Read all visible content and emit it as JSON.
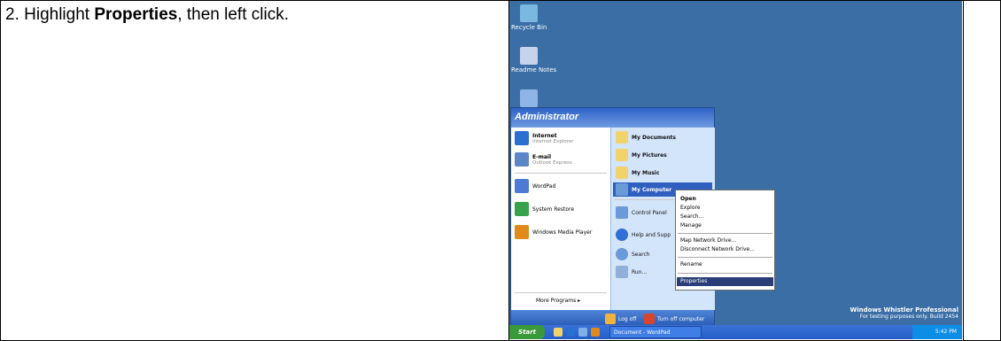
{
  "instruction": {
    "step": "2. Highlight ",
    "bold": "Properties",
    "rest": ", then left click."
  },
  "desktop": {
    "icons": [
      {
        "label": "Recycle Bin",
        "icon": "recycle-bin-icon",
        "color": "#7ab8e0"
      },
      {
        "label": "Readme Notes",
        "icon": "notes-icon",
        "color": "#c6d3ea"
      }
    ],
    "watermark_line1": "Windows Whistler Professional",
    "watermark_line2": "For testing purposes only. Build 2454"
  },
  "start_menu": {
    "user": "Administrator",
    "left_items": [
      {
        "title": "Internet",
        "sub": "Internet Explorer",
        "icon": "internet-explorer-icon",
        "color": "#2b6fd1"
      },
      {
        "title": "E-mail",
        "sub": "Outlook Express",
        "icon": "email-icon",
        "color": "#5b86c7"
      },
      {
        "title": "WordPad",
        "sub": "",
        "icon": "wordpad-icon",
        "color": "#4d7bd4"
      },
      {
        "title": "System Restore",
        "sub": "",
        "icon": "system-restore-icon",
        "color": "#38a24a"
      },
      {
        "title": "Windows Media Player",
        "sub": "",
        "icon": "media-player-icon",
        "color": "#e08a1c"
      }
    ],
    "more_programs": "More Programs ▸",
    "right_items": [
      {
        "label": "My Documents",
        "icon": "folder-icon",
        "color": "#f2d36b"
      },
      {
        "label": "My Pictures",
        "icon": "folder-icon",
        "color": "#f2d36b"
      },
      {
        "label": "My Music",
        "icon": "folder-icon",
        "color": "#f2d36b"
      },
      {
        "label": "My Computer",
        "icon": "computer-icon",
        "color": "#6a9bd8"
      },
      {
        "label": "Control Panel",
        "icon": "control-panel-icon",
        "color": "#6a9bd8"
      },
      {
        "label": "Help and Supp",
        "icon": "help-icon",
        "color": "#2f6fd6"
      },
      {
        "label": "Search",
        "icon": "search-icon",
        "color": "#6a9bd8"
      },
      {
        "label": "Run...",
        "icon": "run-icon",
        "color": "#8fb0d8"
      }
    ],
    "log_off": "Log off",
    "turn_off": "Turn off computer"
  },
  "context_menu": {
    "items": [
      {
        "label": "Open",
        "bold": true
      },
      {
        "label": "Explore",
        "bold": false
      },
      {
        "label": "Search...",
        "bold": false
      },
      {
        "label": "Manage",
        "bold": false
      },
      {
        "label": "Map Network Drive...",
        "bold": false
      },
      {
        "label": "Disconnect Network Drive...",
        "bold": false
      },
      {
        "label": "Rename",
        "bold": false
      },
      {
        "label": "Properties",
        "bold": false,
        "highlighted": true
      }
    ]
  },
  "taskbar": {
    "start": "Start",
    "task": "Document - WordPad",
    "time": "5:42 PM"
  }
}
